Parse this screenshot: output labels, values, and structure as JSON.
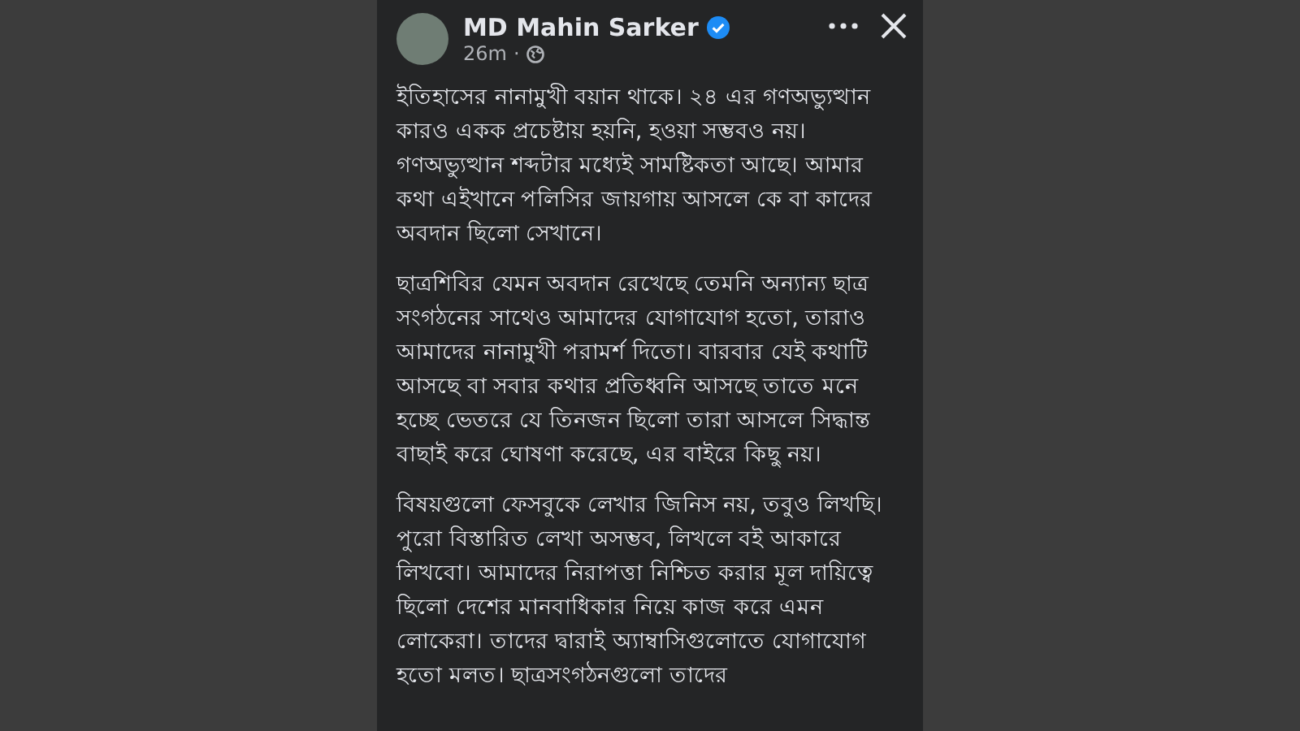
{
  "post": {
    "author": "MD Mahin Sarker",
    "verified": true,
    "time": "26m",
    "separator": "·",
    "paragraphs": [
      "ইতিহাসের নানামুখী বয়ান থাকে। ২৪ এর গণঅভ্যুত্থান কারও একক প্রচেষ্টায় হয়নি, হওয়া সম্ভবও নয়। গণঅভ্যুত্থান শব্দটার মধ্যেই সামষ্টিকতা আছে। আমার কথা এইখানে পলিসির জায়গায় আসলে কে বা কাদের অবদান ছিলো সেখানে।",
      "ছাত্রশিবির যেমন অবদান রেখেছে তেমনি অন্যান্য ছাত্র সংগঠনের সাথেও আমাদের যোগাযোগ হতো, তারাও আমাদের নানামুখী পরামর্শ দিতো। বারবার যেই কথাটি আসছে বা সবার কথার প্রতিধ্বনি আসছে তাতে মনে হচ্ছে ভেতরে যে তিনজন ছিলো তারা আসলে সিদ্ধান্ত বাছাই করে ঘোষণা করেছে, এর বাইরে কিছু নয়।",
      "বিষয়গুলো ফেসবুকে লেখার জিনিস নয়, তবুও লিখছি। পুরো বিস্তারিত লেখা অসম্ভব, লিখলে বই আকারে লিখবো। আমাদের নিরাপত্তা নিশ্চিত করার মূল দায়িত্বে ছিলো দেশের মানবাধিকার নিয়ে কাজ করে এমন লোকেরা। তাদের দ্বারাই অ্যাম্বাসিগুলোতে যোগাযোগ হতো মলত। ছাত্রসংগঠনগুলো তাদের"
    ]
  }
}
